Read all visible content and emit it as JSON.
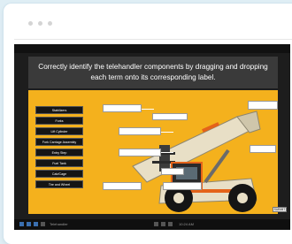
{
  "window": {
    "dots": 3
  },
  "activity": {
    "instruction": "Correctly identify the telehandler components by dragging and dropping each term onto its corresponding label.",
    "terms": [
      {
        "label": "Stabilizers"
      },
      {
        "label": "Forks"
      },
      {
        "label": "Lift Cylinder"
      },
      {
        "label": "Fork Carriage Assembly"
      },
      {
        "label": "Entry Step"
      },
      {
        "label": "Fuel Tank"
      },
      {
        "label": "Cab/Cage"
      },
      {
        "label": "Tire and Wheel"
      }
    ],
    "drop_targets_count": 9,
    "submit_label": "SUBMIT"
  },
  "taskbar": {
    "app_label": "Telehandler",
    "clock": "10:24 AM"
  },
  "colors": {
    "stage": "#f4b11d",
    "machine": "#e8dfc6",
    "tire": "#151515",
    "orange": "#e4631a"
  }
}
